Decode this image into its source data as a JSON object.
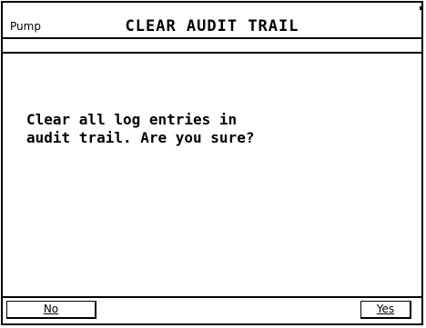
{
  "window": {
    "app_label": "Pump",
    "title": "CLEAR AUDIT TRAIL"
  },
  "dialog": {
    "message_line1": "Clear all log entries in",
    "message_line2": "audit trail. Are you sure?"
  },
  "buttons": {
    "no_label": "No",
    "yes_label": "Yes"
  }
}
